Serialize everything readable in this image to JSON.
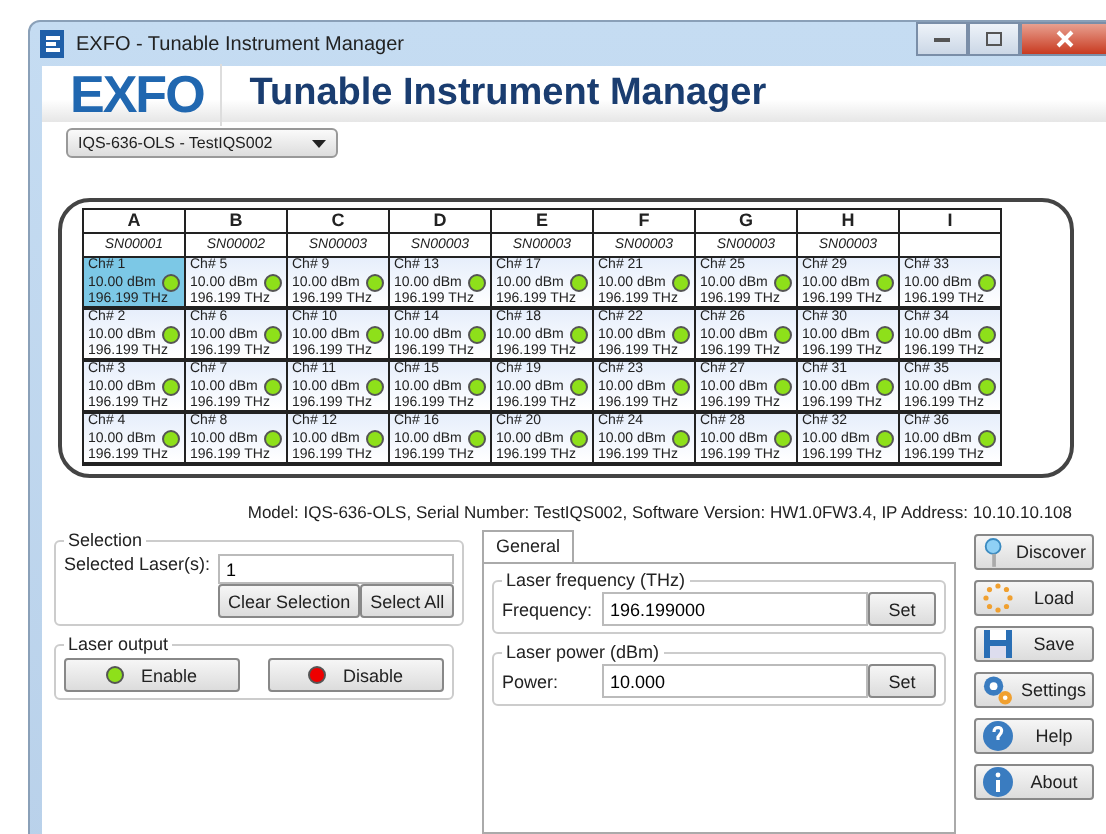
{
  "window": {
    "title": "EXFO - Tunable Instrument Manager"
  },
  "header": {
    "logo": "EXFO",
    "title": "Tunable Instrument Manager"
  },
  "device_select": {
    "value": "IQS-636-OLS - TestIQS002"
  },
  "columns": [
    {
      "letter": "A",
      "serial": "SN00001",
      "channels": [
        {
          "label": "Ch# 1",
          "power": "10.00 dBm",
          "freq": "196.199 THz",
          "selected": true,
          "on": true
        },
        {
          "label": "Ch# 2",
          "power": "10.00 dBm",
          "freq": "196.199 THz",
          "selected": false,
          "on": true
        },
        {
          "label": "Ch# 3",
          "power": "10.00 dBm",
          "freq": "196.199 THz",
          "selected": false,
          "on": true
        },
        {
          "label": "Ch# 4",
          "power": "10.00 dBm",
          "freq": "196.199 THz",
          "selected": false,
          "on": true
        }
      ]
    },
    {
      "letter": "B",
      "serial": "SN00002",
      "channels": [
        {
          "label": "Ch# 5",
          "power": "10.00 dBm",
          "freq": "196.199 THz",
          "selected": false,
          "on": true
        },
        {
          "label": "Ch# 6",
          "power": "10.00 dBm",
          "freq": "196.199 THz",
          "selected": false,
          "on": true
        },
        {
          "label": "Ch# 7",
          "power": "10.00 dBm",
          "freq": "196.199 THz",
          "selected": false,
          "on": true
        },
        {
          "label": "Ch# 8",
          "power": "10.00 dBm",
          "freq": "196.199 THz",
          "selected": false,
          "on": true
        }
      ]
    },
    {
      "letter": "C",
      "serial": "SN00003",
      "channels": [
        {
          "label": "Ch# 9",
          "power": "10.00 dBm",
          "freq": "196.199 THz",
          "selected": false,
          "on": true
        },
        {
          "label": "Ch# 10",
          "power": "10.00 dBm",
          "freq": "196.199 THz",
          "selected": false,
          "on": true
        },
        {
          "label": "Ch# 11",
          "power": "10.00 dBm",
          "freq": "196.199 THz",
          "selected": false,
          "on": true
        },
        {
          "label": "Ch# 12",
          "power": "10.00 dBm",
          "freq": "196.199 THz",
          "selected": false,
          "on": true
        }
      ]
    },
    {
      "letter": "D",
      "serial": "SN00003",
      "channels": [
        {
          "label": "Ch# 13",
          "power": "10.00 dBm",
          "freq": "196.199 THz",
          "selected": false,
          "on": true
        },
        {
          "label": "Ch# 14",
          "power": "10.00 dBm",
          "freq": "196.199 THz",
          "selected": false,
          "on": true
        },
        {
          "label": "Ch# 15",
          "power": "10.00 dBm",
          "freq": "196.199 THz",
          "selected": false,
          "on": true
        },
        {
          "label": "Ch# 16",
          "power": "10.00 dBm",
          "freq": "196.199 THz",
          "selected": false,
          "on": true
        }
      ]
    },
    {
      "letter": "E",
      "serial": "SN00003",
      "channels": [
        {
          "label": "Ch# 17",
          "power": "10.00 dBm",
          "freq": "196.199 THz",
          "selected": false,
          "on": true
        },
        {
          "label": "Ch# 18",
          "power": "10.00 dBm",
          "freq": "196.199 THz",
          "selected": false,
          "on": true
        },
        {
          "label": "Ch# 19",
          "power": "10.00 dBm",
          "freq": "196.199 THz",
          "selected": false,
          "on": true
        },
        {
          "label": "Ch# 20",
          "power": "10.00 dBm",
          "freq": "196.199 THz",
          "selected": false,
          "on": true
        }
      ]
    },
    {
      "letter": "F",
      "serial": "SN00003",
      "channels": [
        {
          "label": "Ch# 21",
          "power": "10.00 dBm",
          "freq": "196.199 THz",
          "selected": false,
          "on": true
        },
        {
          "label": "Ch# 22",
          "power": "10.00 dBm",
          "freq": "196.199 THz",
          "selected": false,
          "on": true
        },
        {
          "label": "Ch# 23",
          "power": "10.00 dBm",
          "freq": "196.199 THz",
          "selected": false,
          "on": true
        },
        {
          "label": "Ch# 24",
          "power": "10.00 dBm",
          "freq": "196.199 THz",
          "selected": false,
          "on": true
        }
      ]
    },
    {
      "letter": "G",
      "serial": "SN00003",
      "channels": [
        {
          "label": "Ch# 25",
          "power": "10.00 dBm",
          "freq": "196.199 THz",
          "selected": false,
          "on": true
        },
        {
          "label": "Ch# 26",
          "power": "10.00 dBm",
          "freq": "196.199 THz",
          "selected": false,
          "on": true
        },
        {
          "label": "Ch# 27",
          "power": "10.00 dBm",
          "freq": "196.199 THz",
          "selected": false,
          "on": true
        },
        {
          "label": "Ch# 28",
          "power": "10.00 dBm",
          "freq": "196.199 THz",
          "selected": false,
          "on": true
        }
      ]
    },
    {
      "letter": "H",
      "serial": "SN00003",
      "channels": [
        {
          "label": "Ch# 29",
          "power": "10.00 dBm",
          "freq": "196.199 THz",
          "selected": false,
          "on": true
        },
        {
          "label": "Ch# 30",
          "power": "10.00 dBm",
          "freq": "196.199 THz",
          "selected": false,
          "on": true
        },
        {
          "label": "Ch# 31",
          "power": "10.00 dBm",
          "freq": "196.199 THz",
          "selected": false,
          "on": true
        },
        {
          "label": "Ch# 32",
          "power": "10.00 dBm",
          "freq": "196.199 THz",
          "selected": false,
          "on": true
        }
      ]
    },
    {
      "letter": "I",
      "channels": [
        {
          "label": "Ch# 33",
          "power": "10.00 dBm",
          "freq": "196.199 THz",
          "selected": false,
          "on": true
        },
        {
          "label": "Ch# 34",
          "power": "10.00 dBm",
          "freq": "196.199 THz",
          "selected": false,
          "on": true
        },
        {
          "label": "Ch# 35",
          "power": "10.00 dBm",
          "freq": "196.199 THz",
          "selected": false,
          "on": true
        },
        {
          "label": "Ch# 36",
          "power": "10.00 dBm",
          "freq": "196.199 THz",
          "selected": false,
          "on": true
        }
      ]
    }
  ],
  "model_line": "Model: IQS-636-OLS, Serial Number: TestIQS002, Software Version: HW1.0FW3.4, IP Address: 10.10.10.108",
  "selection": {
    "title": "Selection",
    "label": "Selected Laser(s):",
    "value": "1",
    "buttons": [
      "Clear Selection",
      "Select All"
    ]
  },
  "laser_output": {
    "title": "Laser output",
    "buttons": [
      {
        "label": "Enable",
        "kind": "enable"
      },
      {
        "label": "Disable",
        "kind": "disable"
      }
    ]
  },
  "tabs": [
    {
      "label": "General",
      "selected": true
    }
  ],
  "groups": [
    {
      "title": "Laser frequency (THz)",
      "label": "Frequency:",
      "value": "196.199000",
      "button": "Set"
    },
    {
      "title": "Laser power (dBm)",
      "label": "Power:",
      "value": "10.000",
      "button": "Set"
    }
  ],
  "side_buttons": [
    {
      "label": "Discover",
      "kind": "discover"
    },
    {
      "label": "Load",
      "kind": "load"
    },
    {
      "label": "Save",
      "kind": "save"
    },
    {
      "label": "Settings",
      "kind": "settings"
    },
    {
      "label": "Help",
      "kind": "help"
    },
    {
      "label": "About",
      "kind": "about"
    }
  ]
}
